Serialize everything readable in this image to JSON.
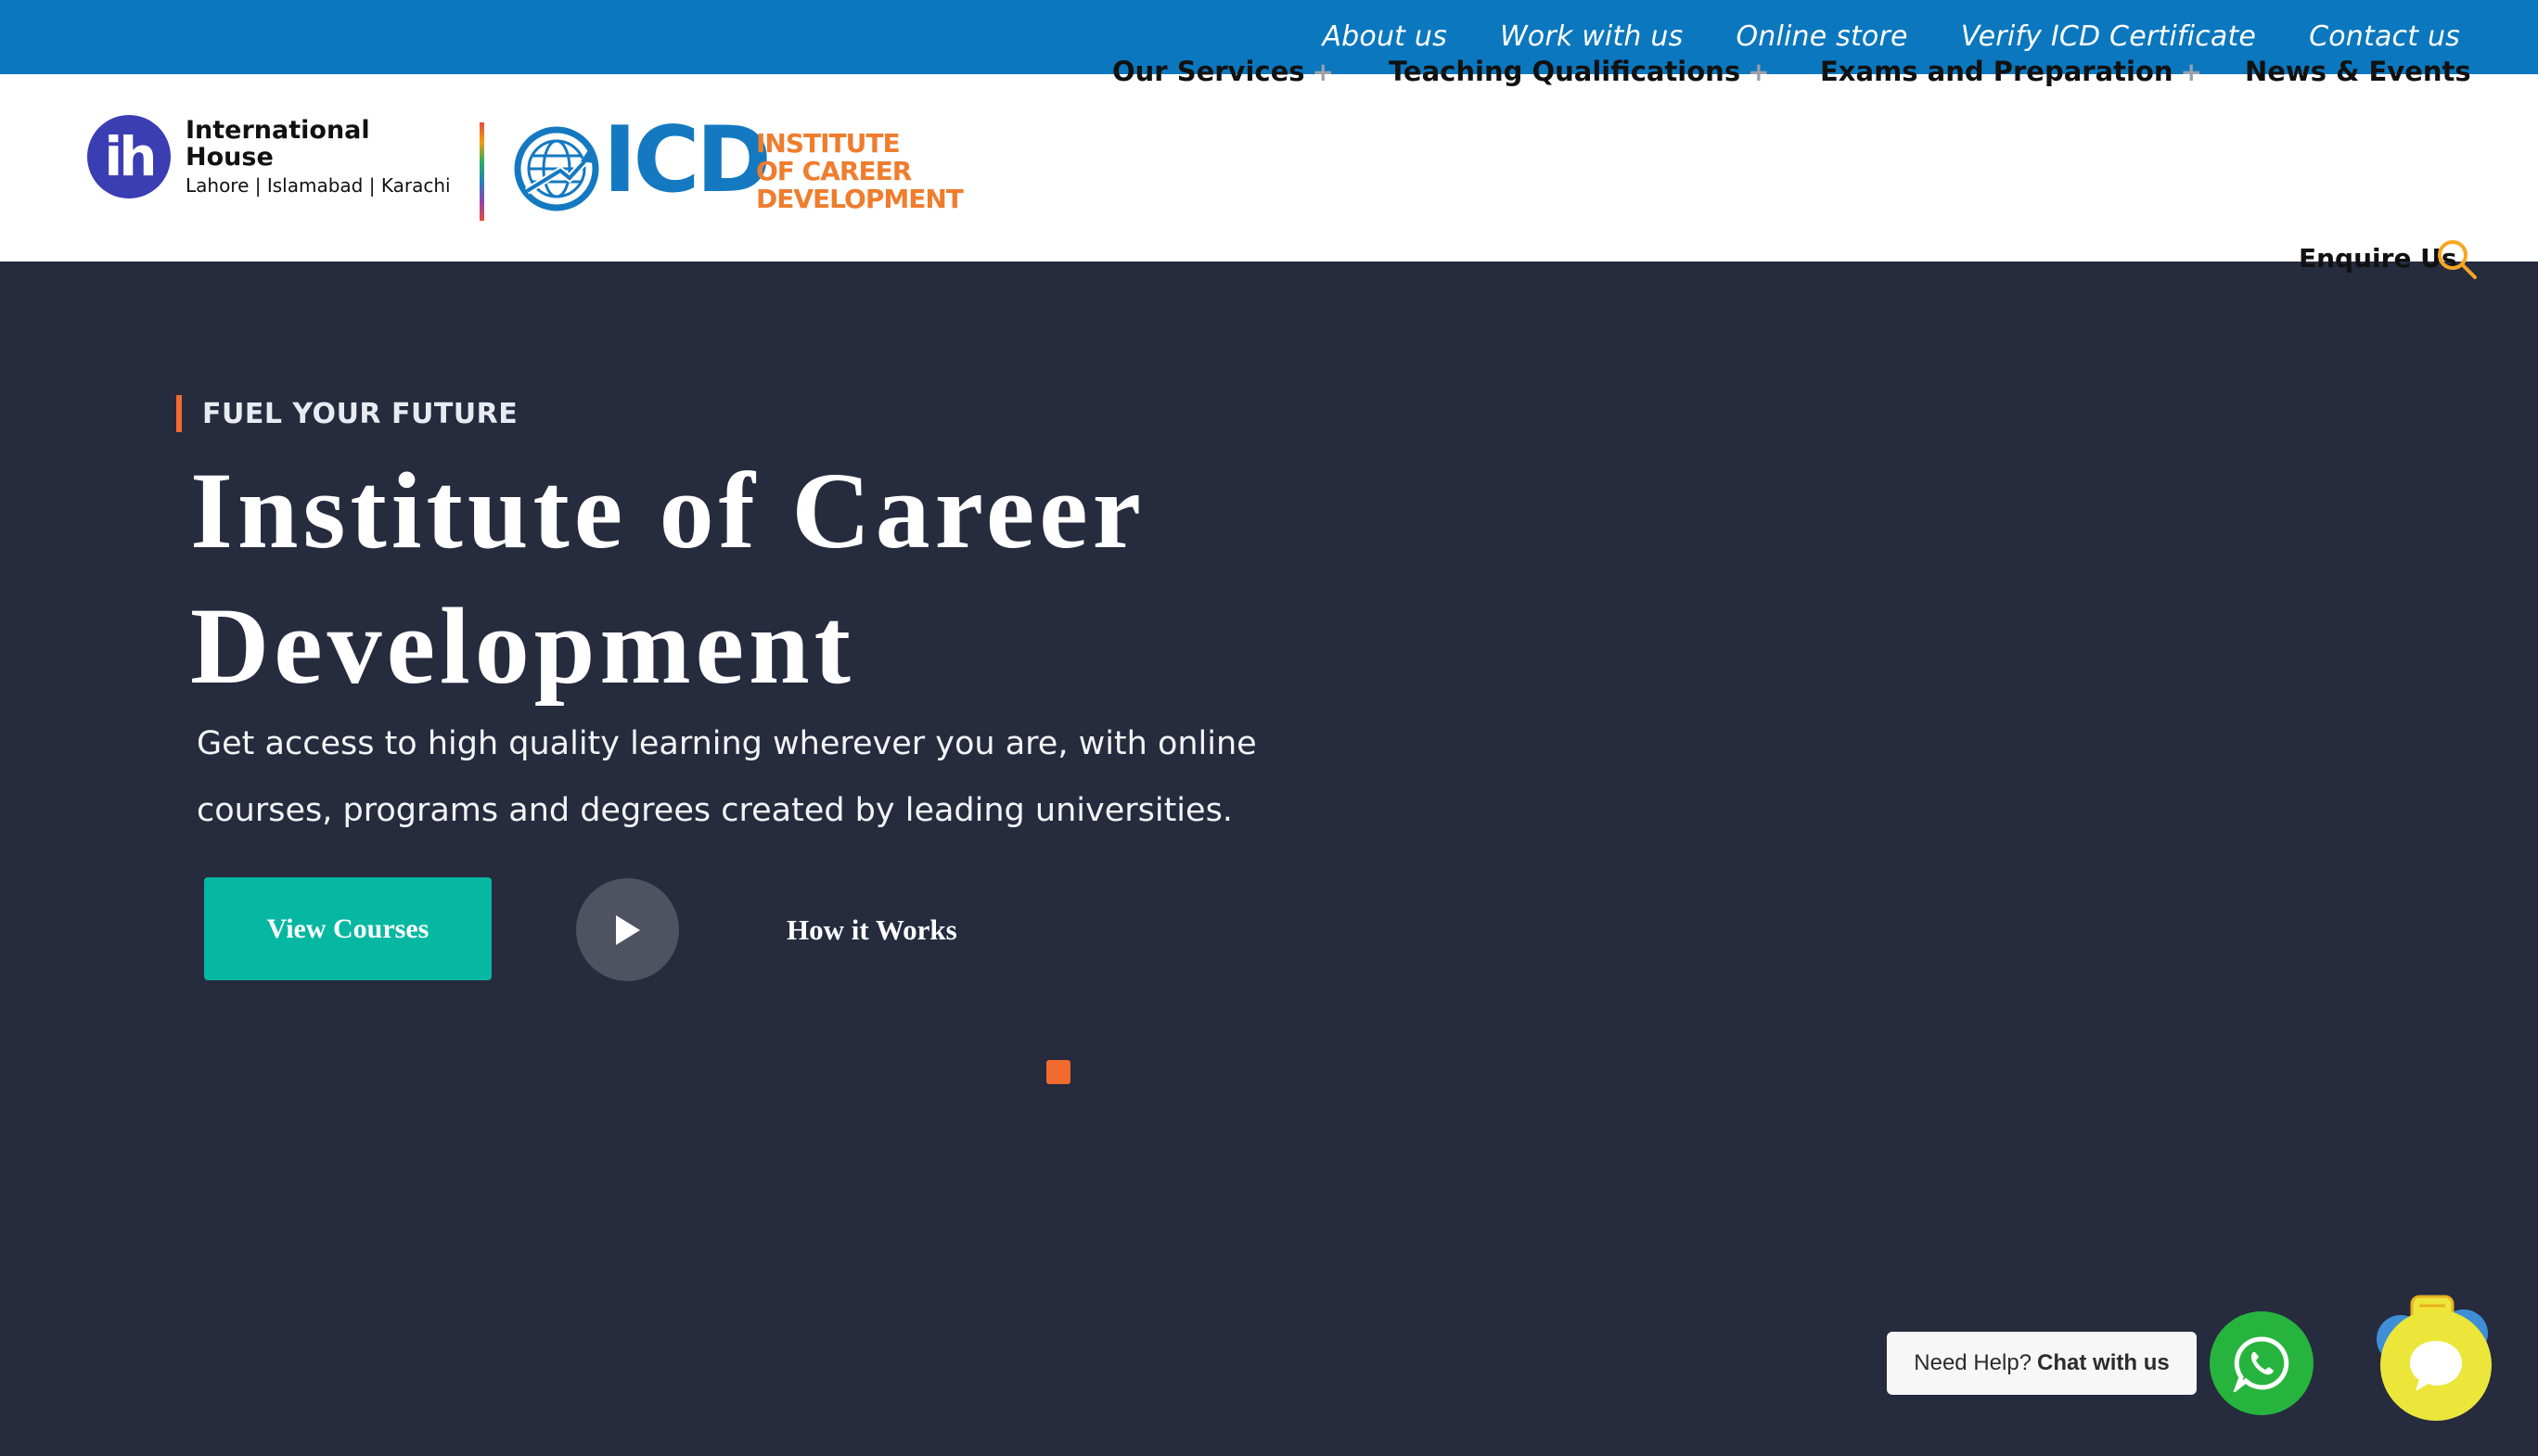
{
  "top_links": [
    "About us",
    "Work with us",
    "Online store",
    "Verify ICD Certificate",
    "Contact us"
  ],
  "nav": {
    "services": "Our Services",
    "teaching": "Teaching Qualifications",
    "exams": "Exams and Preparation",
    "news": "News & Events",
    "plus": "+"
  },
  "logo": {
    "ih_mark": "ih",
    "ih_name_line1": "International",
    "ih_name_line2": "House",
    "ih_cities": "Lahore | Islamabad | Karachi",
    "icd_word": "ICD",
    "icd_sub_line1": "INSTITUTE",
    "icd_sub_line2": "OF CAREER",
    "icd_sub_line3": "DEVELOPMENT"
  },
  "header": {
    "enquire": "Enquire Us"
  },
  "hero": {
    "eyebrow": "FUEL YOUR FUTURE",
    "title_line1": "Institute of Career",
    "title_line2": "Development",
    "description": "Get access to high quality learning wherever you are, with online courses, programs and degrees created by leading universities.",
    "cta_primary": "View Courses",
    "cta_secondary": "How it Works"
  },
  "chat": {
    "help_prefix": "Need Help?",
    "help_action": "Chat with us"
  },
  "colors": {
    "topbar": "#0b77be",
    "hero_bg": "#262b3e",
    "accent_orange": "#f16b2f",
    "cta_teal": "#06b8a2",
    "whatsapp_green": "#27b43e",
    "chat_yellow": "#ece63b"
  },
  "icons": [
    "play-icon",
    "search-icon",
    "whatsapp-icon",
    "chat-icon",
    "globe-icon"
  ]
}
